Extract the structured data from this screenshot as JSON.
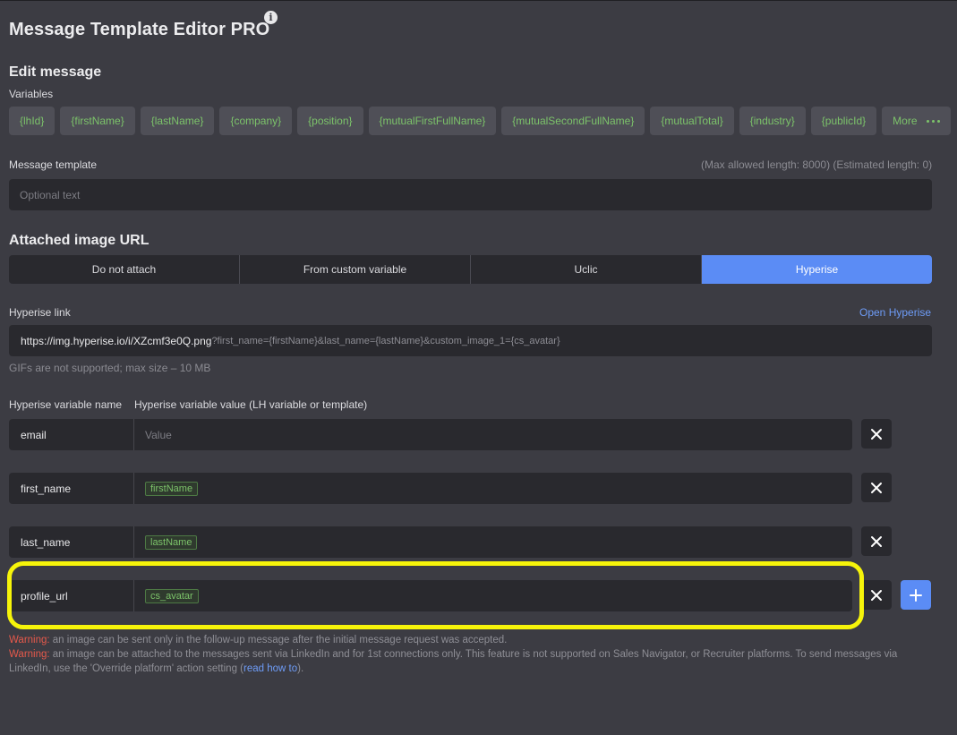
{
  "header": {
    "title": "Message Template Editor PRO",
    "info_icon": "info-icon"
  },
  "edit": {
    "heading": "Edit message",
    "variables_label": "Variables",
    "variables": [
      "{lhId}",
      "{firstName}",
      "{lastName}",
      "{company}",
      "{position}",
      "{mutualFirstFullName}",
      "{mutualSecondFullName}",
      "{mutualTotal}",
      "{industry}",
      "{publicId}"
    ],
    "more_label": "More"
  },
  "template": {
    "label": "Message template",
    "length_info": "(Max allowed length: 8000) (Estimated length: 0)",
    "placeholder": "Optional text"
  },
  "attached": {
    "heading": "Attached image URL",
    "options": [
      "Do not attach",
      "From custom variable",
      "Uclic",
      "Hyperise"
    ],
    "selected": "Hyperise"
  },
  "hyperise": {
    "link_label": "Hyperise link",
    "open_link": "Open Hyperise",
    "url_main": "https://img.hyperise.io/i/XZcmf3e0Q.png",
    "url_query": "?first_name={firstName}&last_name={lastName}&custom_image_1={cs_avatar}",
    "hint": "GIFs are not supported; max size – 10 MB",
    "col_name": "Hyperise variable name",
    "col_value": "Hyperise variable value (LH variable or template)",
    "value_placeholder": "Value",
    "rows": [
      {
        "name": "email",
        "value": ""
      },
      {
        "name": "first_name",
        "value": "firstName"
      },
      {
        "name": "last_name",
        "value": "lastName"
      },
      {
        "name": "profile_url",
        "value": "cs_avatar"
      }
    ]
  },
  "warnings": {
    "prefix": "Warning:",
    "w1": " an image can be sent only in the follow-up message after the initial message request was accepted.",
    "w2_a": " an image can be attached to the messages sent via LinkedIn and for 1st connections only. This feature is not supported on Sales Navigator, or Recruiter platforms. To send messages via LinkedIn, use the 'Override platform' action setting (",
    "w2_link": "read how to",
    "w2_b": ")."
  },
  "colors": {
    "background": "#3c3c43",
    "accent": "#5b8cf5",
    "variable_green": "#7cc36a",
    "warning_red": "#e5594b",
    "highlight_yellow": "#f6f40a"
  }
}
